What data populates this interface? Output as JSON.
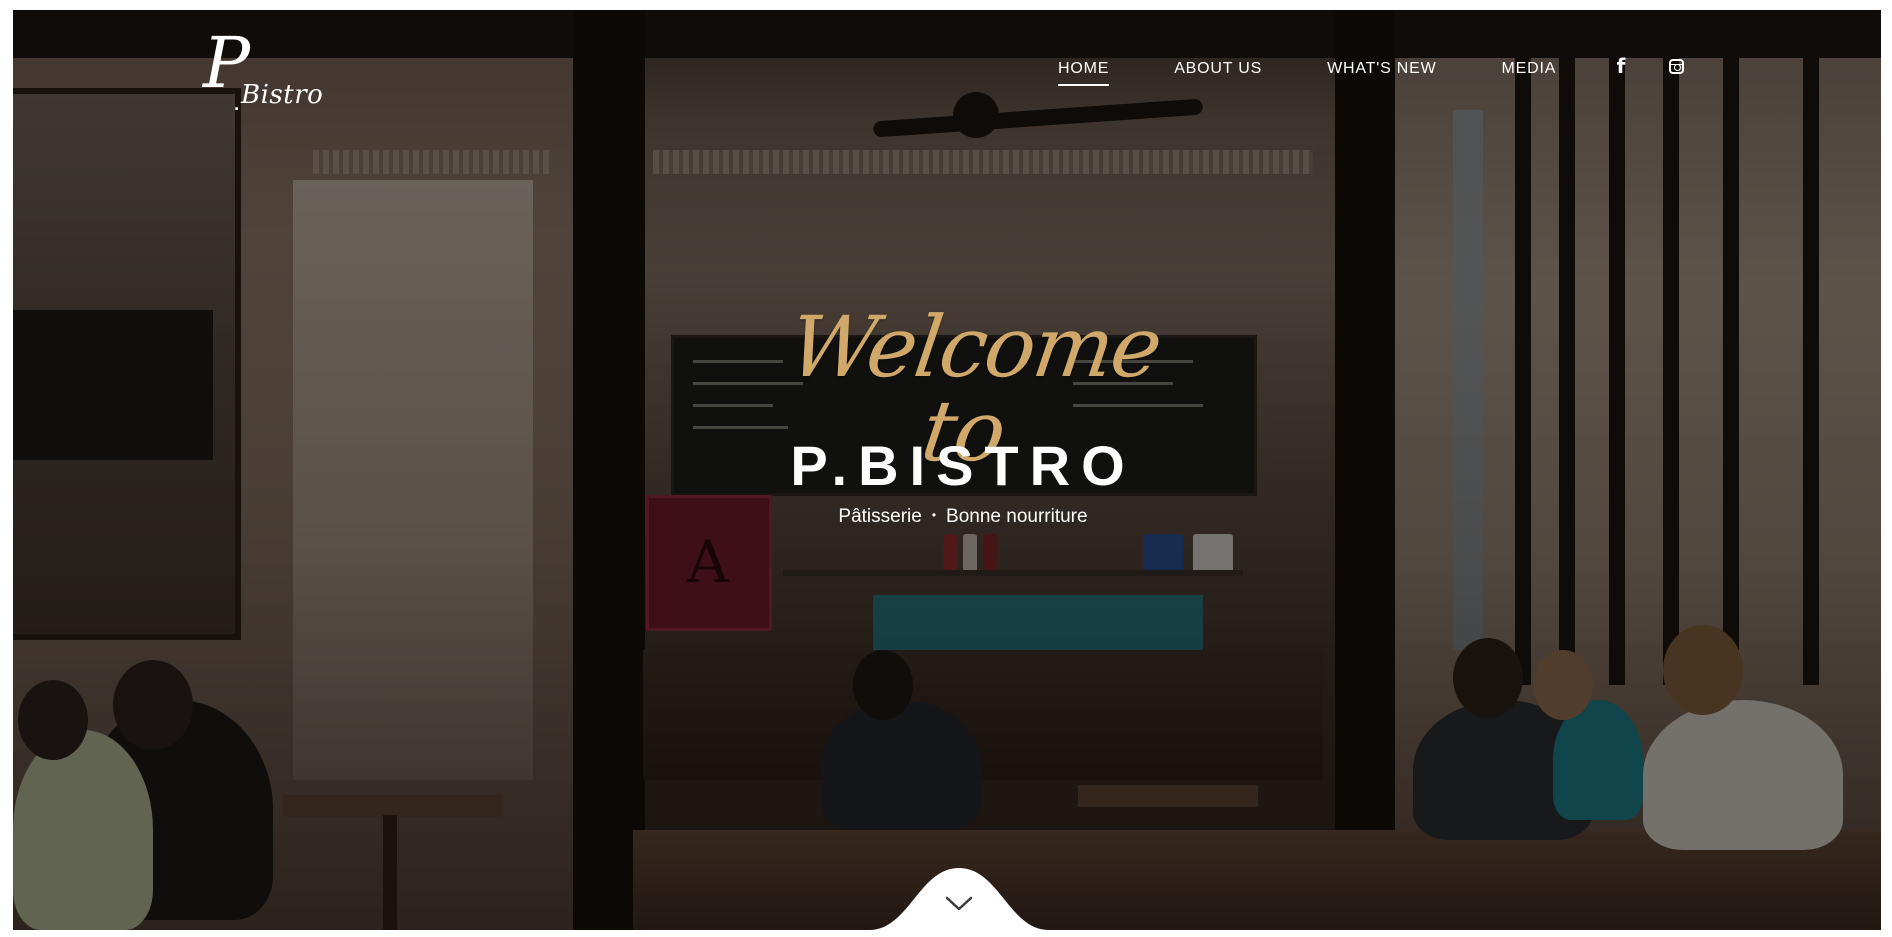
{
  "logo": {
    "letter": "P",
    "dot": ".",
    "word": "Bistro"
  },
  "nav": {
    "items": [
      {
        "label": "HOME",
        "active": true
      },
      {
        "label": "ABOUT US",
        "active": false
      },
      {
        "label": "WHAT'S NEW",
        "active": false
      },
      {
        "label": "MEDIA",
        "active": false
      }
    ],
    "social": [
      {
        "icon": "facebook-icon",
        "glyph": "f"
      },
      {
        "icon": "instagram-icon"
      }
    ]
  },
  "hero": {
    "welcome": "Welcome to",
    "brand": "P.BISTRO",
    "tagline_left": "Pâtisserie",
    "tagline_sep": "•",
    "tagline_right": "Bonne nourriture"
  },
  "scroll": {
    "icon": "chevron-down-icon"
  },
  "colors": {
    "accent_gold": "#d0a869",
    "text": "#ffffff",
    "overlay": "rgba(0,0,0,0.42)"
  }
}
